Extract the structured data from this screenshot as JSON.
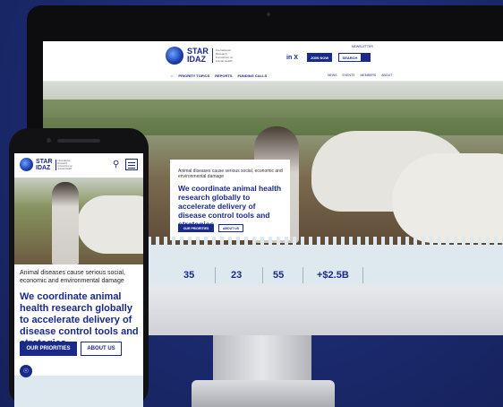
{
  "brand": {
    "name_line1": "STAR",
    "name_line2": "IDAZ",
    "tagline": "International Research Consortium on Animal Health"
  },
  "desktop": {
    "newsletter_link": "NEWSLETTER",
    "social": [
      "in",
      "X"
    ],
    "join_button": "JOIN NOW",
    "search_button": "SEARCH",
    "nav_main": [
      "PRIORITY TOPICS",
      "REPORTS",
      "FUNDING CALLS"
    ],
    "nav_secondary": [
      "NEWS",
      "EVENTS",
      "MEMBERS",
      "ABOUT"
    ],
    "hero": {
      "subtitle": "Animal diseases cause serious social, economic and environmental damage",
      "headline": "We coordinate animal health research globally to accelerate delivery of disease control tools and strategies",
      "primary_button": "OUR PRIORITIES",
      "secondary_button": "ABOUT US"
    },
    "stats": [
      "35",
      "23",
      "55",
      "+$2.5B"
    ]
  },
  "mobile": {
    "hero": {
      "subtitle": "Animal diseases cause serious social, economic and environmental damage",
      "headline": "We coordinate animal health research globally to accelerate delivery of disease control tools and strategies",
      "primary_button": "OUR PRIORITIES",
      "secondary_button": "ABOUT US"
    }
  },
  "colors": {
    "brand_blue": "#1a2a8a",
    "background": "#1b2a6e",
    "stats_bg": "#dde8ef"
  }
}
